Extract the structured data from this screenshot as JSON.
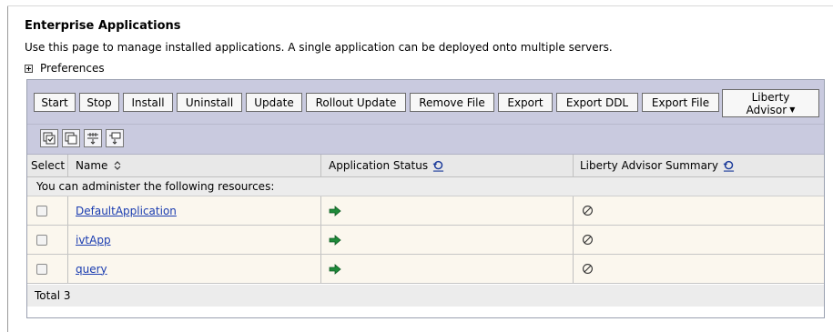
{
  "page": {
    "title": "Enterprise Applications",
    "description": "Use this page to manage installed applications. A single application can be deployed onto multiple servers.",
    "preferences_label": "Preferences"
  },
  "toolbar": {
    "buttons": [
      "Start",
      "Stop",
      "Install",
      "Uninstall",
      "Update",
      "Rollout Update",
      "Remove File",
      "Export",
      "Export DDL",
      "Export File"
    ],
    "liberty_advisor": {
      "line1": "Liberty",
      "line2": "Advisor"
    }
  },
  "icon_toolbar": [
    "select-all-icon",
    "deselect-all-icon",
    "show-filter-icon",
    "clear-filter-icon"
  ],
  "table": {
    "headers": {
      "select": "Select",
      "name": "Name",
      "status": "Application Status",
      "summary": "Liberty Advisor Summary"
    },
    "info_text": "You can administer the following resources:",
    "rows": [
      {
        "name": "DefaultApplication",
        "status_icon": "started-arrow-icon",
        "summary_icon": "not-applicable-icon"
      },
      {
        "name": "ivtApp",
        "status_icon": "started-arrow-icon",
        "summary_icon": "not-applicable-icon"
      },
      {
        "name": "query",
        "status_icon": "started-arrow-icon",
        "summary_icon": "not-applicable-icon"
      }
    ],
    "total_label": "Total 3"
  },
  "colors": {
    "toolbar_bg": "#c9cadf",
    "row_bg": "#fbf7ee",
    "link": "#1a3cb0",
    "status_arrow": "#1f8a3a"
  }
}
